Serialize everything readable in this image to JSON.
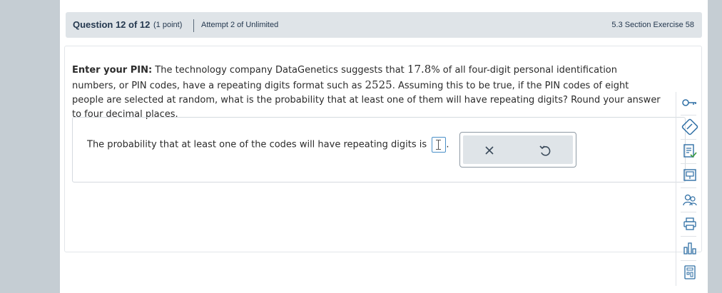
{
  "header": {
    "question_number": "Question 12 of 12",
    "points": "(1 point)",
    "attempt": "Attempt 2 of Unlimited",
    "section": "5.3 Section Exercise 58"
  },
  "question": {
    "lead": "Enter your PIN:",
    "text_1": " The technology company DataGenetics suggests that ",
    "percent_value": "17.8",
    "text_2": "% of all four-digit personal identification numbers, or PIN codes, have a repeating digits format such as ",
    "example_value": "2525",
    "text_3": ". Assuming this to be true, if the PIN codes of eight people are selected at random, what is the probability that at least one of them will have repeating digits? Round your answer to four decimal places."
  },
  "answer": {
    "prompt": "The probability that at least one of the codes will have repeating digits is",
    "suffix": ".",
    "value": ""
  },
  "popup": {
    "clear_symbol": "✕",
    "undo_symbol": "↺"
  },
  "toolbar": {
    "icons": [
      "key-icon",
      "pencil-icon",
      "help-me-solve-icon",
      "view-example-icon",
      "ask-instructor-icon",
      "print-icon",
      "statcrunch-icon",
      "calculator-icon"
    ]
  }
}
